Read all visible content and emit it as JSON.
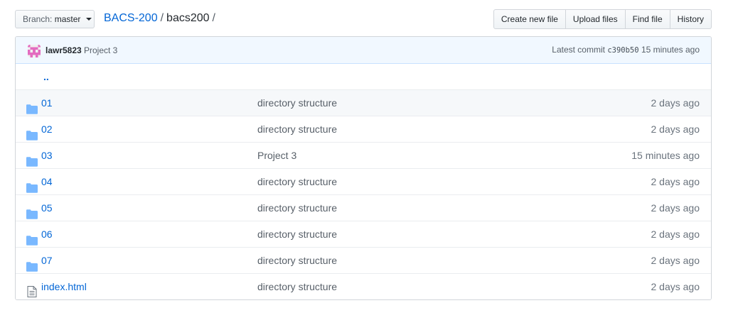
{
  "toolbar": {
    "branch_prefix": "Branch:",
    "branch_name": "master",
    "breadcrumb_repo": "BACS-200",
    "breadcrumb_sep1": "/",
    "breadcrumb_dir": "bacs200",
    "breadcrumb_sep2": "/",
    "buttons": {
      "create_new_file": "Create new file",
      "upload_files": "Upload files",
      "find_file": "Find file",
      "history": "History"
    }
  },
  "latest_commit": {
    "author": "lawr5823",
    "message": "Project 3",
    "label": "Latest commit",
    "sha": "c390b50",
    "age": "15 minutes ago"
  },
  "up_link": "..",
  "files": [
    {
      "name": "01",
      "type": "directory",
      "icon": "folder-icon",
      "message": "directory structure",
      "age": "2 days ago"
    },
    {
      "name": "02",
      "type": "directory",
      "icon": "folder-icon",
      "message": "directory structure",
      "age": "2 days ago"
    },
    {
      "name": "03",
      "type": "directory",
      "icon": "folder-icon",
      "message": "Project 3",
      "age": "15 minutes ago"
    },
    {
      "name": "04",
      "type": "directory",
      "icon": "folder-icon",
      "message": "directory structure",
      "age": "2 days ago"
    },
    {
      "name": "05",
      "type": "directory",
      "icon": "folder-icon",
      "message": "directory structure",
      "age": "2 days ago"
    },
    {
      "name": "06",
      "type": "directory",
      "icon": "folder-icon",
      "message": "directory structure",
      "age": "2 days ago"
    },
    {
      "name": "07",
      "type": "directory",
      "icon": "folder-icon",
      "message": "directory structure",
      "age": "2 days ago"
    },
    {
      "name": "index.html",
      "type": "file",
      "icon": "file-icon",
      "message": "directory structure",
      "age": "2 days ago"
    }
  ],
  "colors": {
    "link": "#0366d6",
    "folder_icon": "#79b8ff",
    "commit_bar_bg": "#f1f8ff",
    "avatar": "#e36cc0"
  }
}
